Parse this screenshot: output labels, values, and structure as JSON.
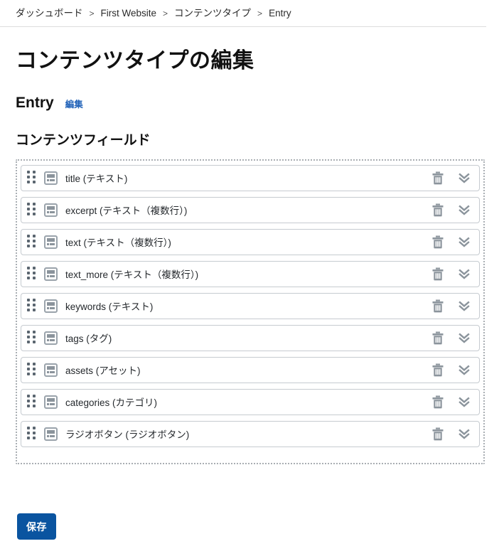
{
  "breadcrumb": {
    "separator": ">",
    "items": [
      {
        "label": "ダッシュボード"
      },
      {
        "label": "First Website"
      },
      {
        "label": "コンテンツタイプ"
      },
      {
        "label": "Entry"
      }
    ]
  },
  "page": {
    "title": "コンテンツタイプの編集",
    "subtitle_name": "Entry",
    "subtitle_edit_label": "編集",
    "section_heading": "コンテンツフィールド"
  },
  "fields": {
    "rows": [
      {
        "label": "title (テキスト)",
        "type_icon": "text-field-icon",
        "delete_icon": "trash-icon",
        "expand_icon": "chevron-double-down-icon"
      },
      {
        "label": "excerpt (テキスト（複数行）)",
        "type_icon": "text-field-icon",
        "delete_icon": "trash-icon",
        "expand_icon": "chevron-double-down-icon"
      },
      {
        "label": "text (テキスト（複数行）)",
        "type_icon": "text-field-icon",
        "delete_icon": "trash-icon",
        "expand_icon": "chevron-double-down-icon"
      },
      {
        "label": "text_more (テキスト（複数行）)",
        "type_icon": "text-field-icon",
        "delete_icon": "trash-icon",
        "expand_icon": "chevron-double-down-icon"
      },
      {
        "label": "keywords (テキスト)",
        "type_icon": "text-field-icon",
        "delete_icon": "trash-icon",
        "expand_icon": "chevron-double-down-icon"
      },
      {
        "label": "tags (タグ)",
        "type_icon": "text-field-icon",
        "delete_icon": "trash-icon",
        "expand_icon": "chevron-double-down-icon"
      },
      {
        "label": "assets (アセット)",
        "type_icon": "text-field-icon",
        "delete_icon": "trash-icon",
        "expand_icon": "chevron-double-down-icon"
      },
      {
        "label": "categories (カテゴリ)",
        "type_icon": "text-field-icon",
        "delete_icon": "trash-icon",
        "expand_icon": "chevron-double-down-icon"
      },
      {
        "label": "ラジオボタン (ラジオボタン)",
        "type_icon": "text-field-icon",
        "delete_icon": "trash-icon",
        "expand_icon": "chevron-double-down-icon"
      }
    ]
  },
  "footer": {
    "save_label": "保存"
  },
  "colors": {
    "link": "#1f61b8",
    "primary_button": "#0a54a0",
    "icon_gray": "#8b949c",
    "row_border": "#c6cbd0",
    "dotted_border": "#a9aeb3",
    "text": "#25292d"
  }
}
